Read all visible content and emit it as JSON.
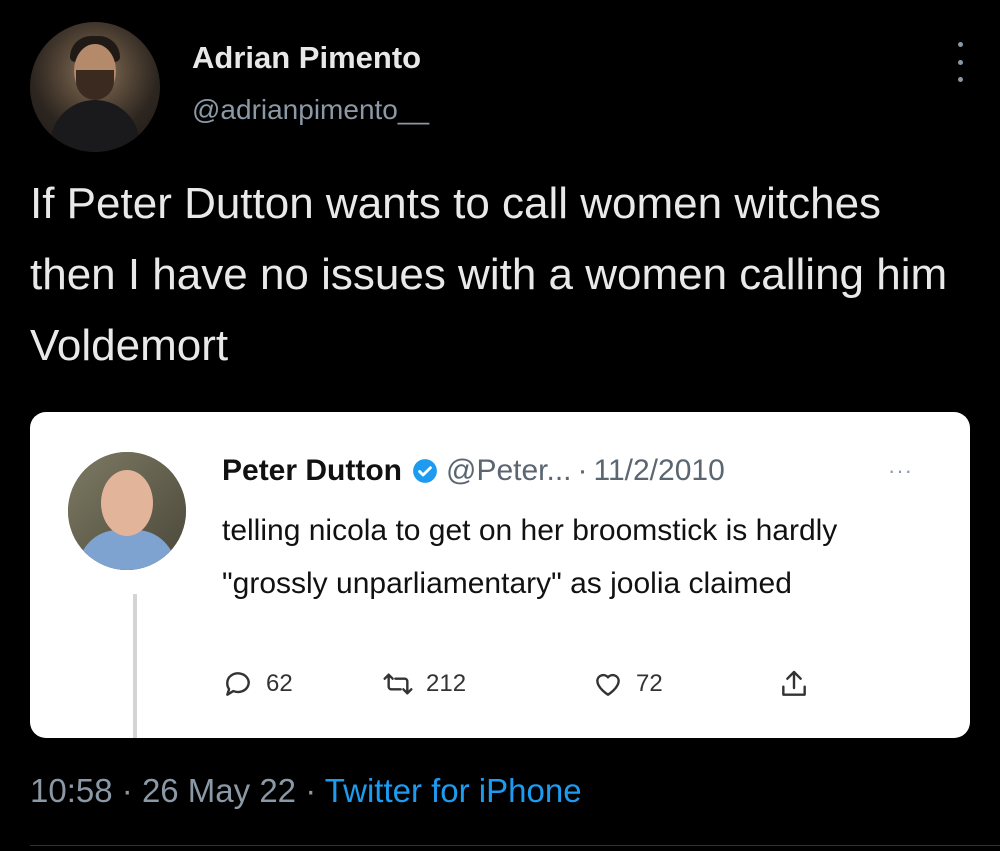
{
  "tweet": {
    "author_name": "Adrian Pimento",
    "author_handle": "@adrianpimento__",
    "text": "If Peter Dutton wants to call women witches then I have no issues with a women calling him Voldemort",
    "time": "10:58",
    "date": "26 May 22",
    "separator": "·",
    "source": "Twitter for iPhone",
    "more_icon": "more-vertical-icon"
  },
  "quote": {
    "author_name": "Peter Dutton",
    "verified_icon": "verified-badge-icon",
    "author_handle": "@Peter...",
    "separator": "·",
    "date": "11/2/2010",
    "more_label": "···",
    "text": "telling nicola to get on her broomstick is hardly \"grossly unparliamentary\" as joolia claimed",
    "actions": {
      "reply_count": "62",
      "retweet_count": "212",
      "like_count": "72"
    }
  },
  "colors": {
    "background": "#000000",
    "card": "#ffffff",
    "muted": "#8b98a5",
    "link": "#1d9bf0",
    "verified": "#1d9bf0"
  }
}
